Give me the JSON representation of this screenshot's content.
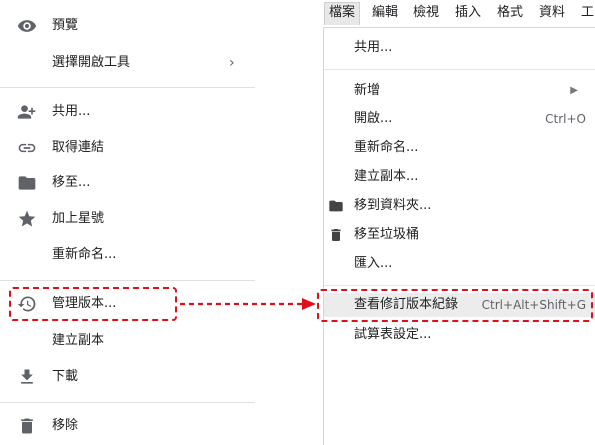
{
  "left_menu": {
    "items": [
      {
        "label": "預覽",
        "icon": "eye-icon"
      },
      {
        "label": "選擇開啟工具",
        "icon": "",
        "arrow": "›"
      },
      {
        "label": "共用...",
        "icon": "person-add-icon"
      },
      {
        "label": "取得連結",
        "icon": "link-icon"
      },
      {
        "label": "移至...",
        "icon": "folder-icon"
      },
      {
        "label": "加上星號",
        "icon": "star-icon"
      },
      {
        "label": "重新命名...",
        "icon": ""
      },
      {
        "label": "管理版本...",
        "icon": "history-icon"
      },
      {
        "label": "建立副本",
        "icon": ""
      },
      {
        "label": "下載",
        "icon": "download-icon"
      },
      {
        "label": "移除",
        "icon": "trash-icon"
      }
    ]
  },
  "sheets_menu": {
    "menubar": [
      "檔案",
      "編輯",
      "檢視",
      "插入",
      "格式",
      "資料",
      "工"
    ],
    "items": [
      {
        "label": "共用..."
      },
      {
        "label": "新增",
        "arrow": "▶"
      },
      {
        "label": "開啟...",
        "shortcut": "Ctrl+O"
      },
      {
        "label": "重新命名..."
      },
      {
        "label": "建立副本..."
      },
      {
        "label": "移到資料夾...",
        "icon": "folder-icon"
      },
      {
        "label": "移至垃圾桶",
        "icon": "trash-icon"
      },
      {
        "label": "匯入..."
      },
      {
        "label": "查看修訂版本紀錄",
        "shortcut": "Ctrl+Alt+Shift+G"
      },
      {
        "label": "試算表設定..."
      }
    ]
  },
  "colors": {
    "annotation": "#e0101a",
    "icon": "#5f6368",
    "highlight": "#ececec"
  }
}
